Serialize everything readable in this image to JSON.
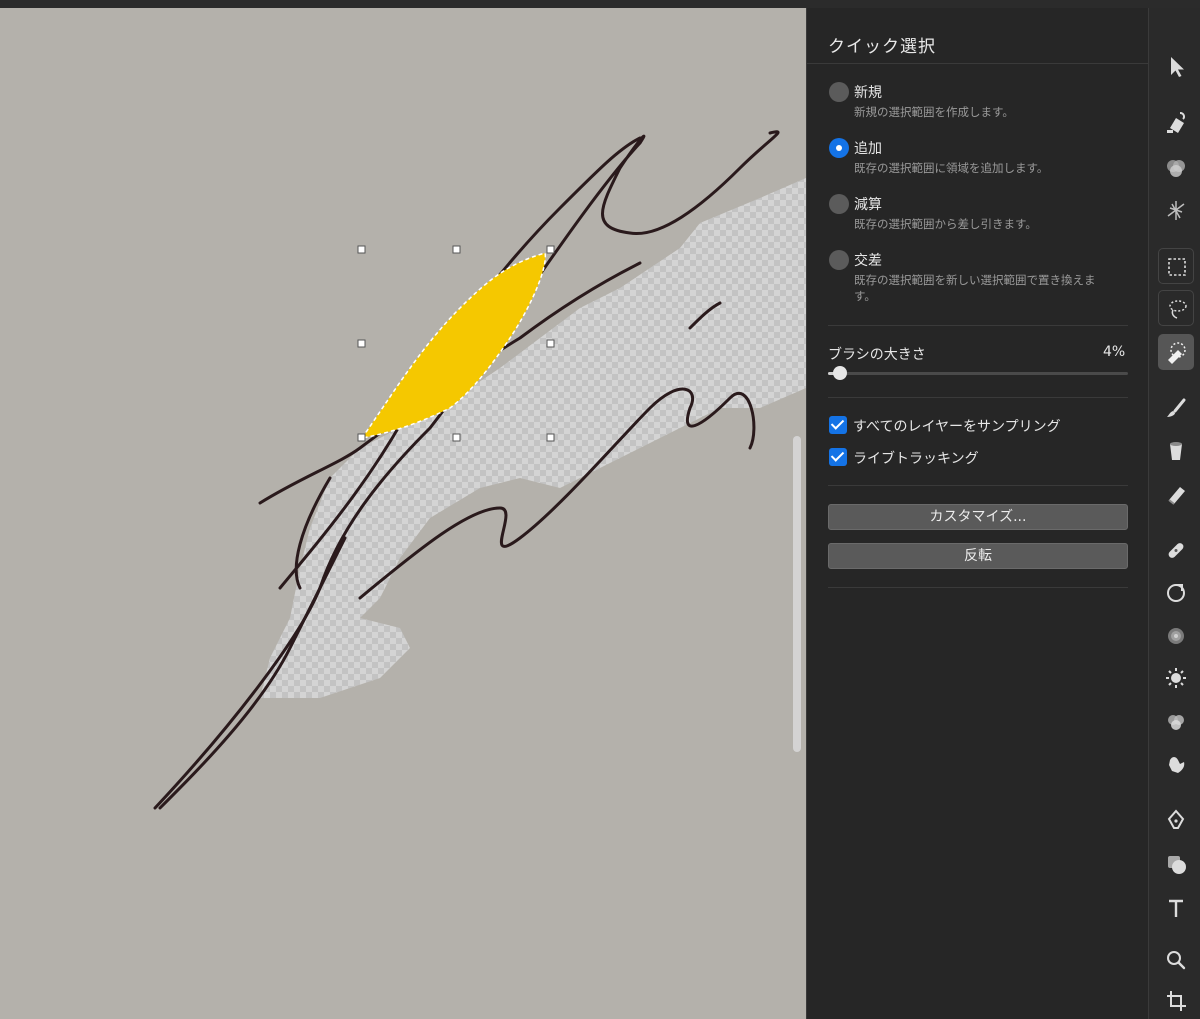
{
  "panel": {
    "title": "クイック選択",
    "modes": [
      {
        "label": "新規",
        "desc": "新規の選択範囲を作成します。",
        "selected": false
      },
      {
        "label": "追加",
        "desc": "既存の選択範囲に領域を追加します。",
        "selected": true
      },
      {
        "label": "減算",
        "desc": "既存の選択範囲から差し引きます。",
        "selected": false
      },
      {
        "label": "交差",
        "desc": "既存の選択範囲を新しい選択範囲で置き換えます。",
        "selected": false
      }
    ],
    "brush_size": {
      "label": "ブラシの大きさ",
      "value_text": "4%",
      "value": 4
    },
    "checkboxes": [
      {
        "label": "すべてのレイヤーをサンプリング",
        "checked": true
      },
      {
        "label": "ライブトラッキング",
        "checked": true
      }
    ],
    "buttons": {
      "customize": "カスタマイズ...",
      "invert": "反転"
    }
  },
  "colors": {
    "accent": "#1473e6",
    "selection_fill": "#f5c800",
    "panel_bg": "#262626",
    "canvas_bg": "#b4b1ab"
  },
  "toolbar": {
    "tools": [
      {
        "name": "select-arrow-icon"
      },
      {
        "name": "paint-bucket-icon"
      },
      {
        "name": "blend-circles-icon"
      },
      {
        "name": "warp-icon"
      },
      {
        "name": "rectangle-marquee-icon"
      },
      {
        "name": "lasso-icon"
      },
      {
        "name": "quick-select-icon",
        "active": true
      },
      {
        "name": "brush-icon"
      },
      {
        "name": "fill-bucket-icon"
      },
      {
        "name": "eraser-icon"
      },
      {
        "name": "bandage-icon"
      },
      {
        "name": "clone-stamp-icon"
      },
      {
        "name": "blur-dots-icon"
      },
      {
        "name": "dodge-sun-icon"
      },
      {
        "name": "color-circles-icon"
      },
      {
        "name": "smudge-hand-icon"
      },
      {
        "name": "pen-nib-icon"
      },
      {
        "name": "shape-icon"
      },
      {
        "name": "text-tool-icon"
      },
      {
        "name": "zoom-icon"
      },
      {
        "name": "crop-icon"
      }
    ]
  }
}
